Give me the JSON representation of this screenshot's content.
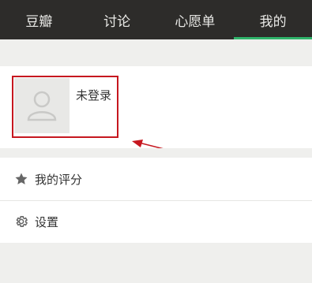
{
  "tabs": [
    {
      "label": "豆瓣"
    },
    {
      "label": "讨论"
    },
    {
      "label": "心愿单"
    },
    {
      "label": "我的",
      "active": true
    }
  ],
  "profile": {
    "login_label": "未登录",
    "avatar_icon": "user-placeholder-icon"
  },
  "menu": [
    {
      "label": "我的评分",
      "icon": "star-icon"
    },
    {
      "label": "设置",
      "icon": "gear-icon"
    }
  ],
  "colors": {
    "topbar_bg": "#2d2c2a",
    "active_tab_indicator": "#2fb36a",
    "highlight_box": "#c6171f",
    "arrow": "#c6171f"
  }
}
